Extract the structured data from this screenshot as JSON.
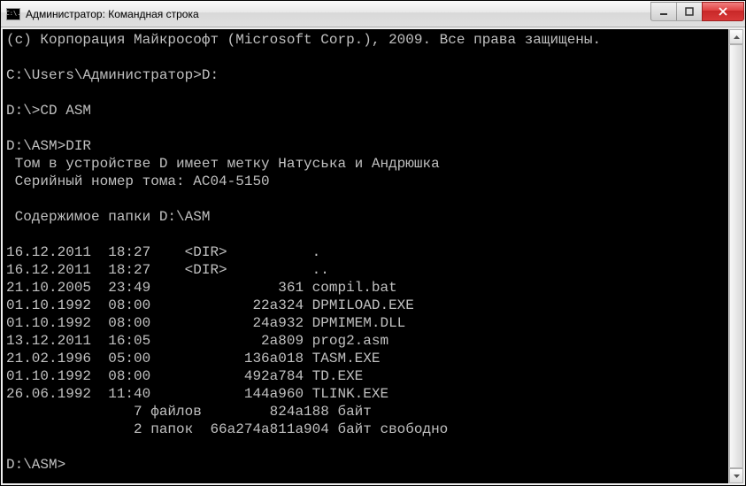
{
  "window": {
    "title": "Администратор: Командная строка",
    "icon_text": "C:\\."
  },
  "terminal": {
    "copyright": "(c) Корпорация Майкрософт (Microsoft Corp.), 2009. Все права защищены.",
    "prompt1": "C:\\Users\\Администратор>D:",
    "prompt2": "D:\\>CD ASM",
    "prompt3": "D:\\ASM>DIR",
    "volume_label": " Том в устройстве D имеет метку Натуська и Андрюшка",
    "serial": " Серийный номер тома: AC04-5150",
    "contents_header": " Содержимое папки D:\\ASM",
    "entries": [
      "16.12.2011  18:27    <DIR>          .",
      "16.12.2011  18:27    <DIR>          ..",
      "21.10.2005  23:49               361 compil.bat",
      "01.10.1992  08:00            22а324 DPMILOAD.EXE",
      "01.10.1992  08:00            24а932 DPMIMEM.DLL",
      "13.12.2011  16:05             2а809 prog2.asm",
      "21.02.1996  05:00           136а018 TASM.EXE",
      "01.10.1992  08:00           492а784 TD.EXE",
      "26.06.1992  11:40           144а960 TLINK.EXE"
    ],
    "summary_files": "               7 файлов        824а188 байт",
    "summary_dirs": "               2 папок  66а274а811а904 байт свободно",
    "prompt4": "D:\\ASM>"
  }
}
